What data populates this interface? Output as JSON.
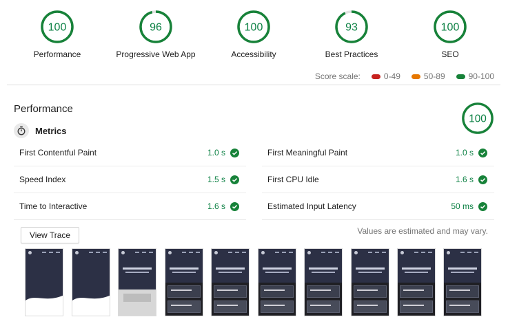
{
  "categories": [
    {
      "label": "Performance",
      "score": "100",
      "fraction": 1.0
    },
    {
      "label": "Progressive Web App",
      "score": "96",
      "fraction": 0.96
    },
    {
      "label": "Accessibility",
      "score": "100",
      "fraction": 1.0
    },
    {
      "label": "Best Practices",
      "score": "93",
      "fraction": 0.93
    },
    {
      "label": "SEO",
      "score": "100",
      "fraction": 1.0
    }
  ],
  "score_scale": {
    "label": "Score scale:",
    "ranges": [
      {
        "label": "0-49",
        "color": "#c7221f"
      },
      {
        "label": "50-89",
        "color": "#e67700"
      },
      {
        "label": "90-100",
        "color": "#178239"
      }
    ]
  },
  "performance": {
    "title": "Performance",
    "score": "100",
    "fraction": 1.0,
    "metrics_title": "Metrics",
    "metrics": [
      {
        "label": "First Contentful Paint",
        "value": "1.0 s"
      },
      {
        "label": "First Meaningful Paint",
        "value": "1.0 s"
      },
      {
        "label": "Speed Index",
        "value": "1.5 s"
      },
      {
        "label": "First CPU Idle",
        "value": "1.6 s"
      },
      {
        "label": "Time to Interactive",
        "value": "1.6 s"
      },
      {
        "label": "Estimated Input Latency",
        "value": "50 ms"
      }
    ],
    "view_trace_label": "View Trace",
    "estimated_note": "Values are estimated and may vary."
  },
  "colors": {
    "pass": "#0b8043",
    "gauge_ring": "#178239",
    "gauge_track": "#e3e3e3"
  },
  "icons": {
    "metrics": "timer-icon",
    "pass": "check-circle-icon"
  }
}
